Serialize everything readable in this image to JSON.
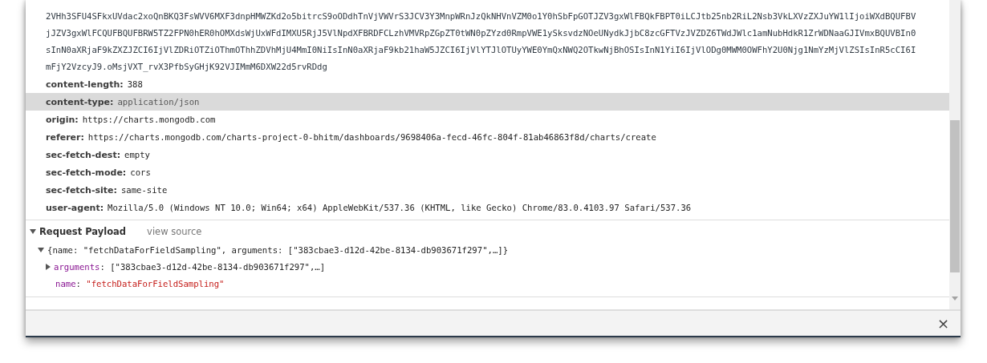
{
  "header_value_continuation": [
    "2VHh3SFU4SFkxUVdac2xoQnBKQ3FsWVV6MXF3dnpHMWZKd2o5bitrcS9oODdhTnVjVWVrS3JCV3Y3MnpWRnJzQkNHVnVZM0o1Y0hSbFpGOTJZV3gxWlFBQkFBPT0iLCJtb25nb2RiL2Nsb3VkLXVzZXJuYW1lIjoiWXdBQUFBV",
    "jJZV3gxWlFCQUFBQUFBRW5TZ2FPN0hER0hOMXdsWjUxWFdIMXU5RjJ5VlNpdXFBRDFCLzhVMVRpZGpZT0tWN0pZYzd0RmpVWE1ySksvdzNOeUNydkJjbC8zcGFTVzJVZDZ6TWdJWlc1amNubHdkR1ZrWDNaaGJIVmxBQUVBIn0",
    "sInN0aXRjaF9kZXZJZCI6IjVlZDRiOTZiOThmOThhZDVhMjU4MmI0NiIsInN0aXRjaF9kb21haW5JZCI6IjVlYTJlOTUyYWE0YmQxNWQ2OTkwNjBhOSIsInN1YiI6IjVlODg0MWM0OWFhY2U0Njg1NmYzMjVlZSIsInR5cCI6I",
    "mFjY2VzcyJ9.oMsjVXT_rvX3PfbSyGHjK92VJIMmM6DXW22d5rvRDdg"
  ],
  "headers": [
    {
      "name": "content-length:",
      "value": "388",
      "selected": false
    },
    {
      "name": "content-type:",
      "value": "application/json",
      "selected": true
    },
    {
      "name": "origin:",
      "value": "https://charts.mongodb.com",
      "selected": false
    },
    {
      "name": "referer:",
      "value": "https://charts.mongodb.com/charts-project-0-bhitm/dashboards/9698406a-fecd-46fc-804f-81ab46863f8d/charts/create",
      "selected": false
    },
    {
      "name": "sec-fetch-dest:",
      "value": "empty",
      "selected": false
    },
    {
      "name": "sec-fetch-mode:",
      "value": "cors",
      "selected": false
    },
    {
      "name": "sec-fetch-site:",
      "value": "same-site",
      "selected": false
    },
    {
      "name": "user-agent:",
      "value": "Mozilla/5.0 (Windows NT 10.0; Win64; x64) AppleWebKit/537.36 (KHTML, like Gecko) Chrome/83.0.4103.97 Safari/537.36",
      "selected": false
    }
  ],
  "payload": {
    "title": "Request Payload",
    "expanded": true,
    "view_source": "view source",
    "root": {
      "summary": "{name: \"fetchDataForFieldSampling\", arguments: [\"383cbae3-d12d-42be-8134-db903671f297\",…]}",
      "expanded": true,
      "children": [
        {
          "key": "arguments",
          "sep": ": ",
          "value": "[\"383cbae3-d12d-42be-8134-db903671f297\",…]",
          "kind": "array",
          "expanded": false
        },
        {
          "key": "name",
          "sep": ": ",
          "value": "\"fetchDataForFieldSampling\"",
          "kind": "string"
        }
      ]
    }
  },
  "drawer": {
    "close": "×"
  }
}
